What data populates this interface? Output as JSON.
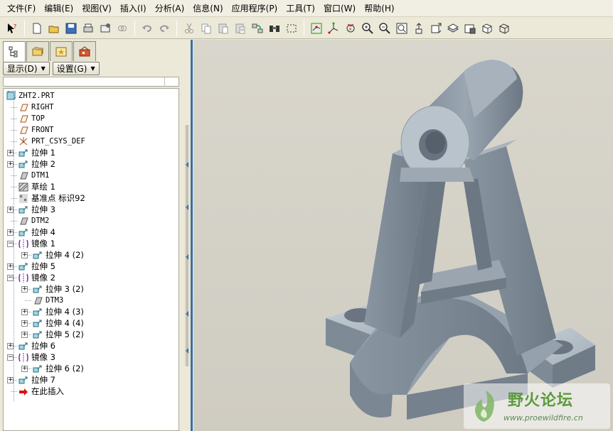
{
  "menubar": {
    "items": [
      "文件(F)",
      "编辑(E)",
      "视图(V)",
      "插入(I)",
      "分析(A)",
      "信息(N)",
      "应用程序(P)",
      "工具(T)",
      "窗口(W)",
      "帮助(H)"
    ]
  },
  "toolbar": {
    "icons": [
      "whats-this-icon",
      "new-icon",
      "open-icon",
      "save-icon",
      "print-icon",
      "send-icon",
      "link-icon",
      "undo-icon",
      "redo-icon",
      "cut-icon",
      "copy-icon",
      "paste-icon",
      "paste-special-icon",
      "regenerate-icon",
      "find-icon",
      "select-box-icon",
      "spin-center-icon",
      "csys-icon",
      "refit-icon",
      "zoom-in-icon",
      "zoom-out-icon",
      "zoom-fit-icon",
      "orient-icon",
      "saved-views-icon",
      "layers-icon",
      "view-manager-icon",
      "display-style-icon",
      "wireframe-icon"
    ]
  },
  "left_panel": {
    "tabs": [
      "model-tree-icon",
      "folder-browser-icon",
      "favorites-icon",
      "connections-icon"
    ],
    "show_button": "显示(D)",
    "settings_button": "设置(G)"
  },
  "tree": {
    "root": "ZHT2.PRT",
    "items": [
      {
        "label": "RIGHT",
        "icon": "datum-plane-icon",
        "indent": 1,
        "expander": false
      },
      {
        "label": "TOP",
        "icon": "datum-plane-icon",
        "indent": 1,
        "expander": false
      },
      {
        "label": "FRONT",
        "icon": "datum-plane-icon",
        "indent": 1,
        "expander": false
      },
      {
        "label": "PRT_CSYS_DEF",
        "icon": "csys-icon",
        "indent": 1,
        "expander": false
      },
      {
        "label": "拉伸 1",
        "icon": "extrude-icon",
        "indent": 1,
        "expander": true
      },
      {
        "label": "拉伸 2",
        "icon": "extrude-icon",
        "indent": 1,
        "expander": true
      },
      {
        "label": "DTM1",
        "icon": "datum-plane-gray-icon",
        "indent": 1,
        "expander": false
      },
      {
        "label": "草绘 1",
        "icon": "sketch-icon",
        "indent": 1,
        "expander": false
      },
      {
        "label": "基准点 标识92",
        "icon": "datum-point-icon",
        "indent": 1,
        "expander": false
      },
      {
        "label": "拉伸 3",
        "icon": "extrude-icon",
        "indent": 1,
        "expander": true
      },
      {
        "label": "DTM2",
        "icon": "datum-plane-gray-icon",
        "indent": 1,
        "expander": false
      },
      {
        "label": "拉伸 4",
        "icon": "extrude-icon",
        "indent": 1,
        "expander": true
      },
      {
        "label": "镜像 1",
        "icon": "mirror-icon",
        "indent": 1,
        "expander": "minus"
      },
      {
        "label": "拉伸 4 (2)",
        "icon": "extrude-icon",
        "indent": 2,
        "expander": true
      },
      {
        "label": "拉伸 5",
        "icon": "extrude-icon",
        "indent": 1,
        "expander": true
      },
      {
        "label": "镜像 2",
        "icon": "mirror-icon",
        "indent": 1,
        "expander": "minus"
      },
      {
        "label": "拉伸 3 (2)",
        "icon": "extrude-icon",
        "indent": 2,
        "expander": true
      },
      {
        "label": "DTM3",
        "icon": "datum-plane-gray-icon",
        "indent": 2,
        "expander": false
      },
      {
        "label": "拉伸 4 (3)",
        "icon": "extrude-icon",
        "indent": 2,
        "expander": true
      },
      {
        "label": "拉伸 4 (4)",
        "icon": "extrude-icon",
        "indent": 2,
        "expander": true
      },
      {
        "label": "拉伸 5 (2)",
        "icon": "extrude-icon",
        "indent": 2,
        "expander": true
      },
      {
        "label": "拉伸 6",
        "icon": "extrude-icon",
        "indent": 1,
        "expander": true
      },
      {
        "label": "镜像 3",
        "icon": "mirror-icon",
        "indent": 1,
        "expander": "minus"
      },
      {
        "label": "拉伸 6 (2)",
        "icon": "extrude-icon",
        "indent": 2,
        "expander": true
      },
      {
        "label": "拉伸 7",
        "icon": "extrude-icon",
        "indent": 1,
        "expander": true
      },
      {
        "label": "在此插入",
        "icon": "insert-here-icon",
        "indent": 1,
        "expander": false
      }
    ]
  },
  "watermark": {
    "title": "野火论坛",
    "url": "www.proewildfire.cn"
  },
  "colors": {
    "model_face_light": "#b9c3cc",
    "model_face_mid": "#8d99a5",
    "model_face_dark": "#6e7a86",
    "viewport_bg": "#d4d1c7"
  }
}
